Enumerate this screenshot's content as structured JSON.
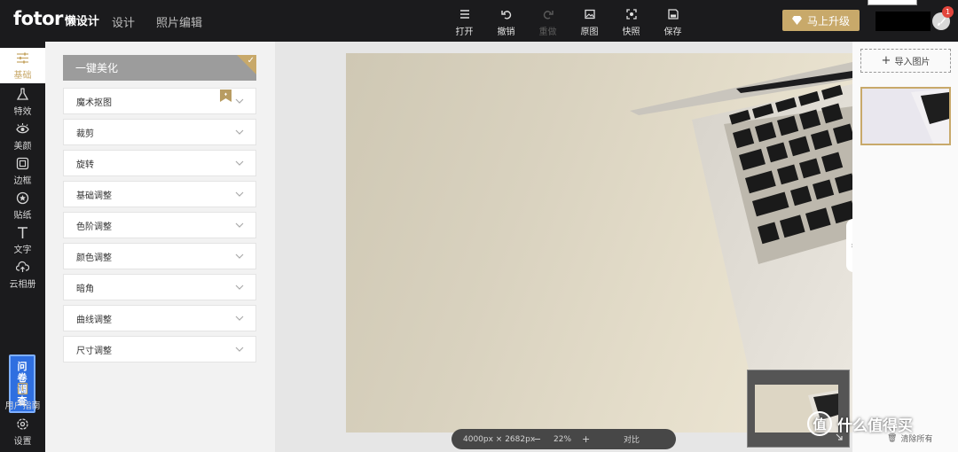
{
  "app": {
    "brand": "fotor",
    "brand_sub": "懒设计",
    "nav": [
      "设计",
      "照片编辑"
    ]
  },
  "toolbar": [
    {
      "label": "打开",
      "icon": "menu-icon",
      "enabled": true
    },
    {
      "label": "撤销",
      "icon": "undo-icon",
      "enabled": true
    },
    {
      "label": "重做",
      "icon": "redo-icon",
      "enabled": false
    },
    {
      "label": "原图",
      "icon": "image-icon",
      "enabled": true
    },
    {
      "label": "快照",
      "icon": "snapshot-icon",
      "enabled": true
    },
    {
      "label": "保存",
      "icon": "save-icon",
      "enabled": true
    }
  ],
  "upgrade_label": "马上升级",
  "notification_count": "1",
  "rail": [
    {
      "label": "基础",
      "icon": "sliders-icon",
      "active": true
    },
    {
      "label": "特效",
      "icon": "flask-icon",
      "active": false
    },
    {
      "label": "美颜",
      "icon": "eye-icon",
      "active": false
    },
    {
      "label": "边框",
      "icon": "frame-icon",
      "active": false
    },
    {
      "label": "贴纸",
      "icon": "sticker-icon",
      "active": false
    },
    {
      "label": "文字",
      "icon": "text-icon",
      "active": false
    },
    {
      "label": "云相册",
      "icon": "cloud-upload-icon",
      "active": false
    }
  ],
  "survey_label": "问卷调查",
  "rail_bottom": [
    {
      "label": "用户指南",
      "icon": "guide-icon"
    },
    {
      "label": "设置",
      "icon": "settings-icon"
    }
  ],
  "panel": {
    "onekey_label": "一键美化",
    "items": [
      "魔术抠图",
      "裁剪",
      "旋转",
      "基础调整",
      "色阶调整",
      "颜色调整",
      "暗角",
      "曲线调整",
      "尺寸调整"
    ]
  },
  "zoom": {
    "dimensions": "4000px × 2682px",
    "minus": "−",
    "level": "22%",
    "plus": "+",
    "compare": "对比"
  },
  "right_panel": {
    "import_label": "导入图片",
    "clear_label": "清除所有"
  },
  "watermark": "什么值得买",
  "colors": {
    "accent": "#c8a96a",
    "topbar": "#1b1b1d",
    "survey": "#2f6fe0"
  }
}
